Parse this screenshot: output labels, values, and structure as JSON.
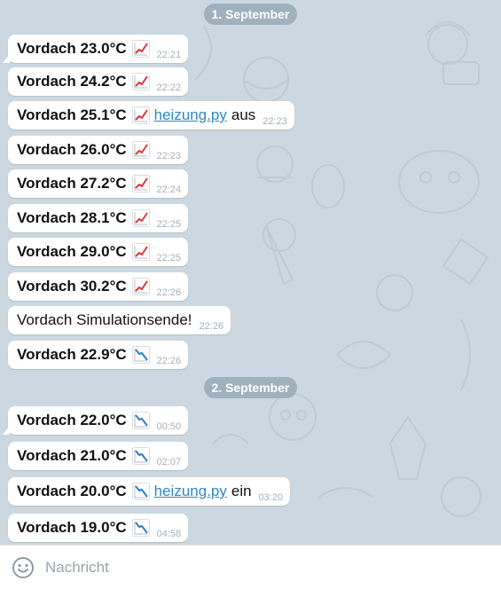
{
  "chat": {
    "dates": [
      "1. September",
      "2. September"
    ],
    "messages": [
      {
        "text": "Vordach 23.0°C",
        "emoji": "chart-increasing-icon",
        "time": "22:21"
      },
      {
        "text": "Vordach 24.2°C",
        "emoji": "chart-increasing-icon",
        "time": "22:22"
      },
      {
        "text": "Vordach 25.1°C",
        "emoji": "chart-increasing-icon",
        "link": "heizung.py",
        "after": "aus",
        "time": "22:23"
      },
      {
        "text": "Vordach 26.0°C",
        "emoji": "chart-increasing-icon",
        "time": "22:23"
      },
      {
        "text": "Vordach 27.2°C",
        "emoji": "chart-increasing-icon",
        "time": "22:24"
      },
      {
        "text": "Vordach 28.1°C",
        "emoji": "chart-increasing-icon",
        "time": "22:25"
      },
      {
        "text": "Vordach 29.0°C",
        "emoji": "chart-increasing-icon",
        "time": "22:25"
      },
      {
        "text": "Vordach 30.2°C",
        "emoji": "chart-increasing-icon",
        "time": "22:26"
      },
      {
        "text": "Vordach Simulationsende!",
        "time": "22:26"
      },
      {
        "text": "Vordach 22.9°C",
        "emoji": "chart-decreasing-icon",
        "time": "22:26"
      },
      {
        "text": "Vordach 22.0°C",
        "emoji": "chart-decreasing-icon",
        "time": "00:50"
      },
      {
        "text": "Vordach 21.0°C",
        "emoji": "chart-decreasing-icon",
        "time": "02:07"
      },
      {
        "text": "Vordach 20.0°C",
        "emoji": "chart-decreasing-icon",
        "link": "heizung.py",
        "after": "ein",
        "time": "03:20"
      },
      {
        "text": "Vordach 19.0°C",
        "emoji": "chart-decreasing-icon",
        "time": "04:58"
      }
    ]
  },
  "input": {
    "placeholder": "Nachricht"
  },
  "colors": {
    "link": "#2f87c9",
    "bubble": "#ffffff",
    "background": "#cbd8e1",
    "date_pill": "#96aab6"
  }
}
